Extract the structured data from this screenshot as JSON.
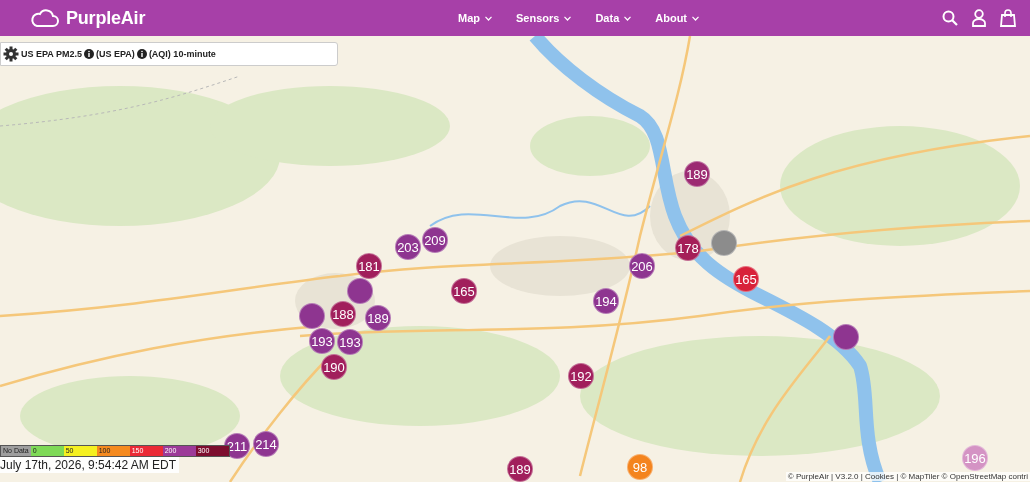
{
  "header": {
    "brand": "PurpleAir",
    "nav": [
      {
        "label": "Map"
      },
      {
        "label": "Sensors"
      },
      {
        "label": "Data"
      },
      {
        "label": "About"
      }
    ]
  },
  "map": {
    "control": {
      "parts": [
        "US EPA PM2.5",
        "(US EPA)",
        "(AQI) 10-minute"
      ]
    },
    "markers": [
      {
        "value": "189",
        "color": "#9c2a72"
      },
      {
        "value": "178",
        "color": "#a51f58"
      },
      {
        "color": "#8c8c8c"
      },
      {
        "value": "165",
        "color": "#d8223a"
      },
      {
        "value": "206",
        "color": "#8e3590"
      },
      {
        "value": "194",
        "color": "#8e3590"
      },
      {
        "value": "203",
        "color": "#8e3590"
      },
      {
        "value": "209",
        "color": "#8e3590"
      },
      {
        "value": "181",
        "color": "#a11f5c"
      },
      {
        "value": "165",
        "color": "#a11f5c"
      },
      {
        "color": "#8e3590"
      },
      {
        "value": "188",
        "color": "#a11f5c"
      },
      {
        "value": "189",
        "color": "#8e3590"
      },
      {
        "color": "#8e3590"
      },
      {
        "value": "193",
        "color": "#8e3590"
      },
      {
        "value": "193",
        "color": "#8e3590"
      },
      {
        "value": "190",
        "color": "#a11f5c"
      },
      {
        "value": "192",
        "color": "#a11f5c"
      },
      {
        "value": "211",
        "color": "#8e3590"
      },
      {
        "value": "214",
        "color": "#8e3590"
      },
      {
        "value": "189",
        "color": "#a11f5c"
      },
      {
        "value": "98",
        "color": "#f4841e"
      },
      {
        "color": "#8e3590"
      },
      {
        "value": "196",
        "color": "#d493c4"
      }
    ],
    "legend": {
      "segments": [
        {
          "label": "No Data",
          "color": "#9e9e9e"
        },
        {
          "label": "0",
          "color": "#7ed957"
        },
        {
          "label": "50",
          "color": "#f5f020"
        },
        {
          "label": "100",
          "color": "#f58a1f"
        },
        {
          "label": "150",
          "color": "#ea2a36"
        },
        {
          "label": "200",
          "color": "#9c3a98"
        },
        {
          "label": "300",
          "color": "#7d0d2e"
        }
      ],
      "timestamp": "July 17th, 2026, 9:54:42 AM EDT"
    },
    "attribution": "© PurpleAir | V3.2.0 | Cookies | © MapTiler © OpenStreetMap contri"
  }
}
